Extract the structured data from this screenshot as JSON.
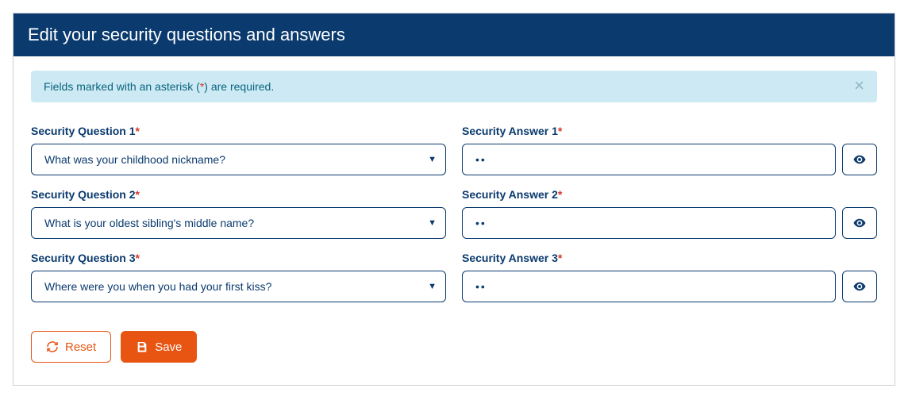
{
  "header": {
    "title": "Edit your security questions and answers"
  },
  "alert": {
    "text_before": "Fields marked with an asterisk (",
    "star": "*",
    "text_after": ") are required."
  },
  "rows": [
    {
      "question_label": "Security Question 1",
      "question_value": "What was your childhood nickname?",
      "answer_label": "Security Answer 1",
      "answer_value": "••"
    },
    {
      "question_label": "Security Question 2",
      "question_value": "What is your oldest sibling's middle name?",
      "answer_label": "Security Answer 2",
      "answer_value": "••"
    },
    {
      "question_label": "Security Question 3",
      "question_value": "Where were you when you had your first kiss?",
      "answer_label": "Security Answer 3",
      "answer_value": "••"
    }
  ],
  "actions": {
    "reset": "Reset",
    "save": "Save"
  }
}
